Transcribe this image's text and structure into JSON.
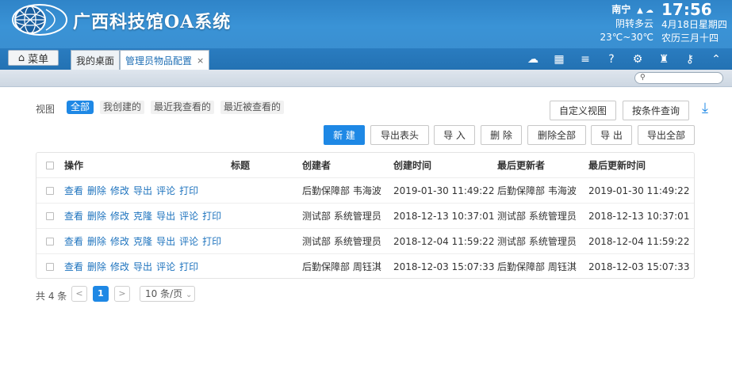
{
  "header": {
    "app_title": "广西科技馆OA系统",
    "weather": {
      "city": "南宁",
      "condition": "阴转多云",
      "temperature": "23℃~30℃"
    },
    "clock": {
      "time": "17:56",
      "date": "4月18日星期四",
      "lunar": "农历三月十四"
    }
  },
  "tabbar": {
    "menu_label": "菜单",
    "tabs": [
      {
        "label": "我的桌面"
      },
      {
        "label": "管理员物品配置",
        "close": "×"
      }
    ],
    "icons": [
      "cloud-up-icon",
      "grid-icon",
      "stack-icon",
      "cloud-help-icon",
      "gear-icon",
      "shirt-icon",
      "key-icon",
      "arrow-up-icon"
    ]
  },
  "toolbar": {
    "view_label": "视图",
    "views": [
      "全部",
      "我创建的",
      "最近我查看的",
      "最近被查看的"
    ],
    "custom_view": "自定义视图",
    "query": "按条件查询",
    "actions": {
      "new": "新 建",
      "export_header": "导出表头",
      "import": "导 入",
      "delete": "删 除",
      "delete_all": "删除全部",
      "export": "导 出",
      "export_all": "导出全部"
    }
  },
  "table": {
    "columns": [
      "操作",
      "标题",
      "创建者",
      "创建时间",
      "最后更新者",
      "最后更新时间"
    ],
    "rows": [
      {
        "ops": [
          "查看",
          "删除",
          "修改",
          "导出",
          "评论",
          "打印"
        ],
        "title": "",
        "creator": "后勤保障部 韦海波",
        "created": "2019-01-30 11:49:22",
        "updater": "后勤保障部 韦海波",
        "updated": "2019-01-30 11:49:22"
      },
      {
        "ops": [
          "查看",
          "删除",
          "修改",
          "克隆",
          "导出",
          "评论",
          "打印"
        ],
        "title": "",
        "creator": "测试部 系统管理员",
        "created": "2018-12-13 10:37:01",
        "updater": "测试部 系统管理员",
        "updated": "2018-12-13 10:37:01"
      },
      {
        "ops": [
          "查看",
          "删除",
          "修改",
          "克隆",
          "导出",
          "评论",
          "打印"
        ],
        "title": "",
        "creator": "测试部 系统管理员",
        "created": "2018-12-04 11:59:22",
        "updater": "测试部 系统管理员",
        "updated": "2018-12-04 11:59:22"
      },
      {
        "ops": [
          "查看",
          "删除",
          "修改",
          "导出",
          "评论",
          "打印"
        ],
        "title": "",
        "creator": "后勤保障部 周钰淇",
        "created": "2018-12-03 15:07:33",
        "updater": "后勤保障部 周钰淇",
        "updated": "2018-12-03 15:07:33"
      }
    ]
  },
  "pager": {
    "total": "共 4 条",
    "prev": "<",
    "current": "1",
    "next": ">",
    "page_size": "10 条/页"
  },
  "colors": {
    "header_blue": "#3a93d6",
    "accent": "#1e88e5",
    "link": "#1e73be"
  }
}
